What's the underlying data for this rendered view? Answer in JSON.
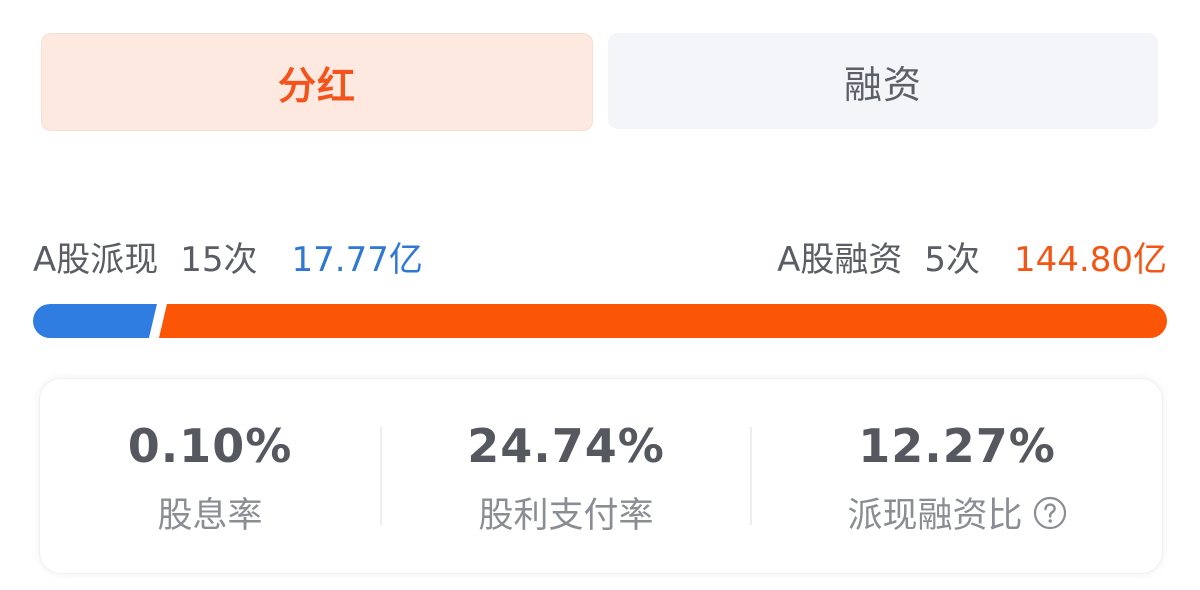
{
  "tabs": [
    {
      "label": "分红",
      "active": true
    },
    {
      "label": "融资",
      "active": false
    }
  ],
  "summary": {
    "dividend": {
      "label": "A股派现",
      "count": "15次",
      "amount": "17.77亿"
    },
    "financing": {
      "label": "A股融资",
      "count": "5次",
      "amount": "144.80亿"
    }
  },
  "ratio": {
    "dividend_value": 17.77,
    "financing_value": 144.8,
    "colors": {
      "dividend": "#2f7de1",
      "financing": "#fb5506"
    }
  },
  "stats": [
    {
      "value": "0.10%",
      "label": "股息率"
    },
    {
      "value": "24.74%",
      "label": "股利支付率"
    },
    {
      "value": "12.27%",
      "label": "派现融资比",
      "icon": "help-circle-icon"
    }
  ]
}
